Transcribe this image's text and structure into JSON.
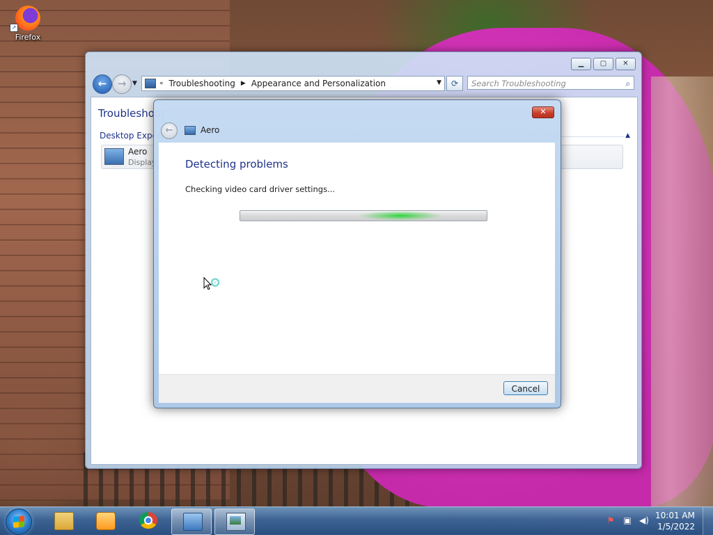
{
  "desktop": {
    "icons": [
      {
        "label": "Firefox"
      }
    ]
  },
  "control_panel": {
    "breadcrumb": [
      "Troubleshooting",
      "Appearance and Personalization"
    ],
    "breadcrumb_prefix": "«",
    "search_placeholder": "Search Troubleshooting",
    "title": "Troubleshoot",
    "group_label": "Desktop Experi",
    "item": {
      "name": "Aero",
      "description": "Display"
    }
  },
  "dialog": {
    "title": "Aero",
    "heading": "Detecting problems",
    "status": "Checking video card driver settings...",
    "progress": "indeterminate",
    "cancel_label": "Cancel"
  },
  "taskbar": {
    "apps": [
      "Windows Explorer",
      "Windows Media Player",
      "Google Chrome",
      "Control Panel",
      "Troubleshooting"
    ],
    "active_app": "Troubleshooting",
    "clock": {
      "time": "10:01 AM",
      "date": "1/5/2022"
    }
  },
  "icons": {
    "start": "windows-start-icon",
    "search": "magnifier-icon",
    "back": "back-arrow-icon",
    "forward": "forward-arrow-icon",
    "refresh": "refresh-icon",
    "close": "close-icon",
    "busy_cursor": "busy-cursor-icon"
  },
  "colors": {
    "heading": "#1e3287",
    "progress_glow": "#2fd63a",
    "close_button": "#c8402d"
  }
}
